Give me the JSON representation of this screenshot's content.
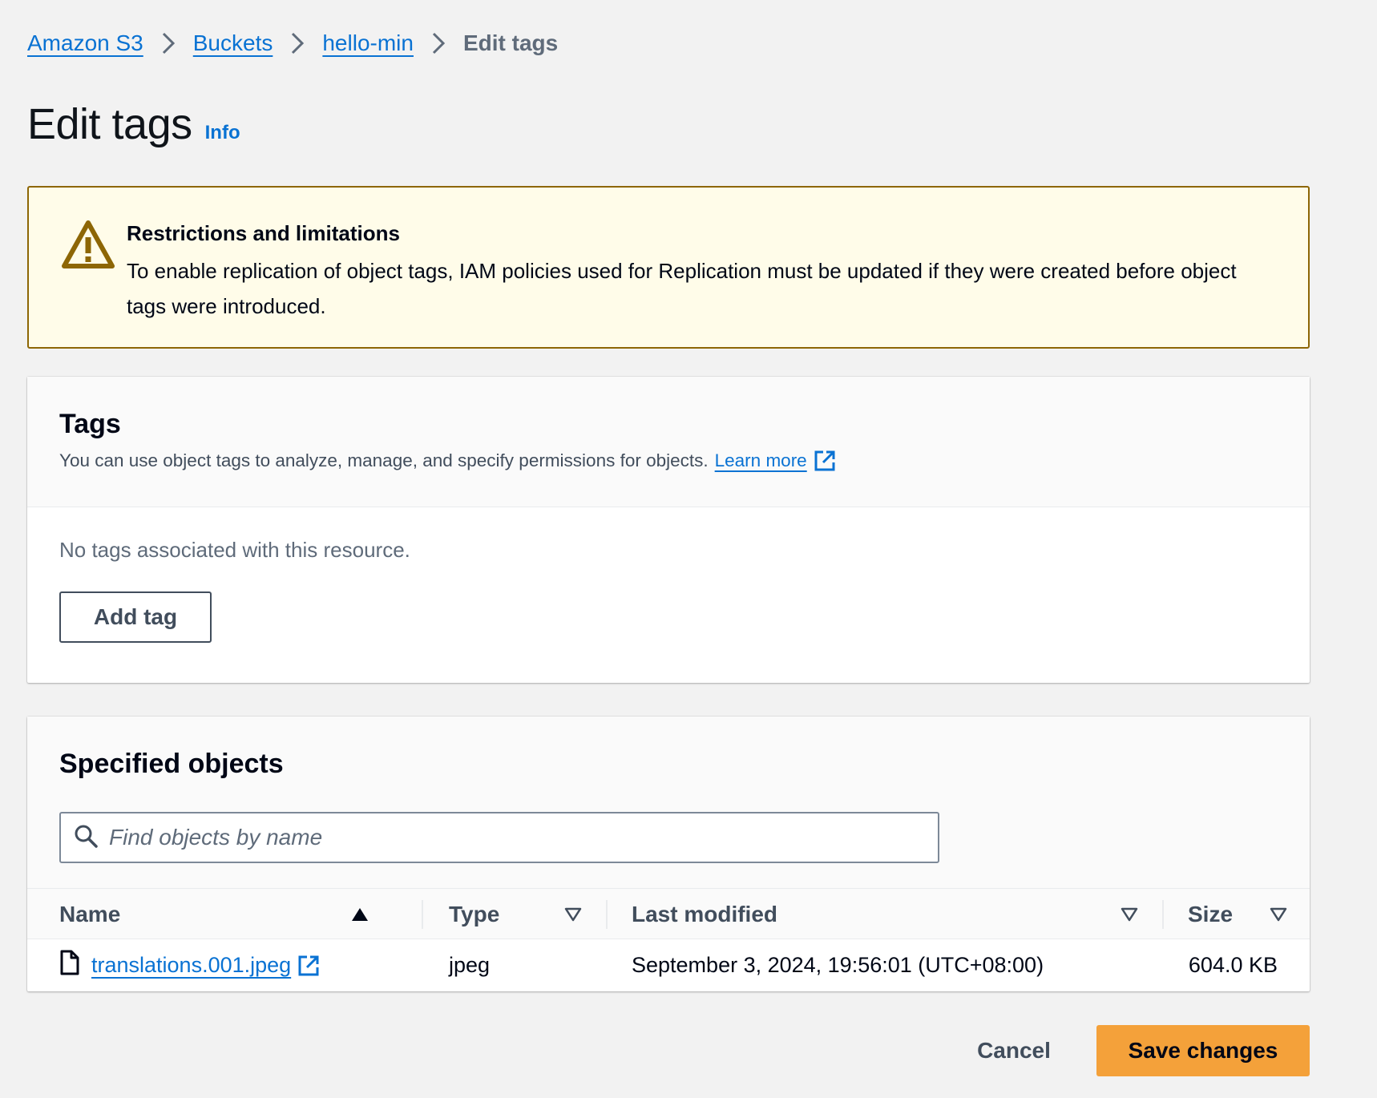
{
  "breadcrumb": {
    "items": [
      "Amazon S3",
      "Buckets",
      "hello-min"
    ],
    "current": "Edit tags"
  },
  "header": {
    "title": "Edit tags",
    "info_label": "Info"
  },
  "alert": {
    "title": "Restrictions and limitations",
    "text": "To enable replication of object tags, IAM policies used for Replication must be updated if they were created before object tags were introduced.",
    "icon": "warning-icon",
    "border_color": "#8d6605",
    "background_color": "#fffce9"
  },
  "tags": {
    "title": "Tags",
    "description": "You can use object tags to analyze, manage, and specify permissions for objects.",
    "learn_more_label": "Learn more",
    "empty_message": "No tags associated with this resource.",
    "add_tag_label": "Add tag"
  },
  "objects": {
    "title": "Specified objects",
    "search_placeholder": "Find objects by name",
    "columns": {
      "name": "Name",
      "type": "Type",
      "last_modified": "Last modified",
      "size": "Size"
    },
    "rows": [
      {
        "name": "translations.001.jpeg",
        "type": "jpeg",
        "last_modified": "September 3, 2024, 19:56:01 (UTC+08:00)",
        "size": "604.0 KB"
      }
    ]
  },
  "footer": {
    "cancel_label": "Cancel",
    "save_label": "Save changes",
    "primary_color": "#f4a13a"
  },
  "colors": {
    "link": "#0972d3",
    "background": "#f2f2f2"
  }
}
